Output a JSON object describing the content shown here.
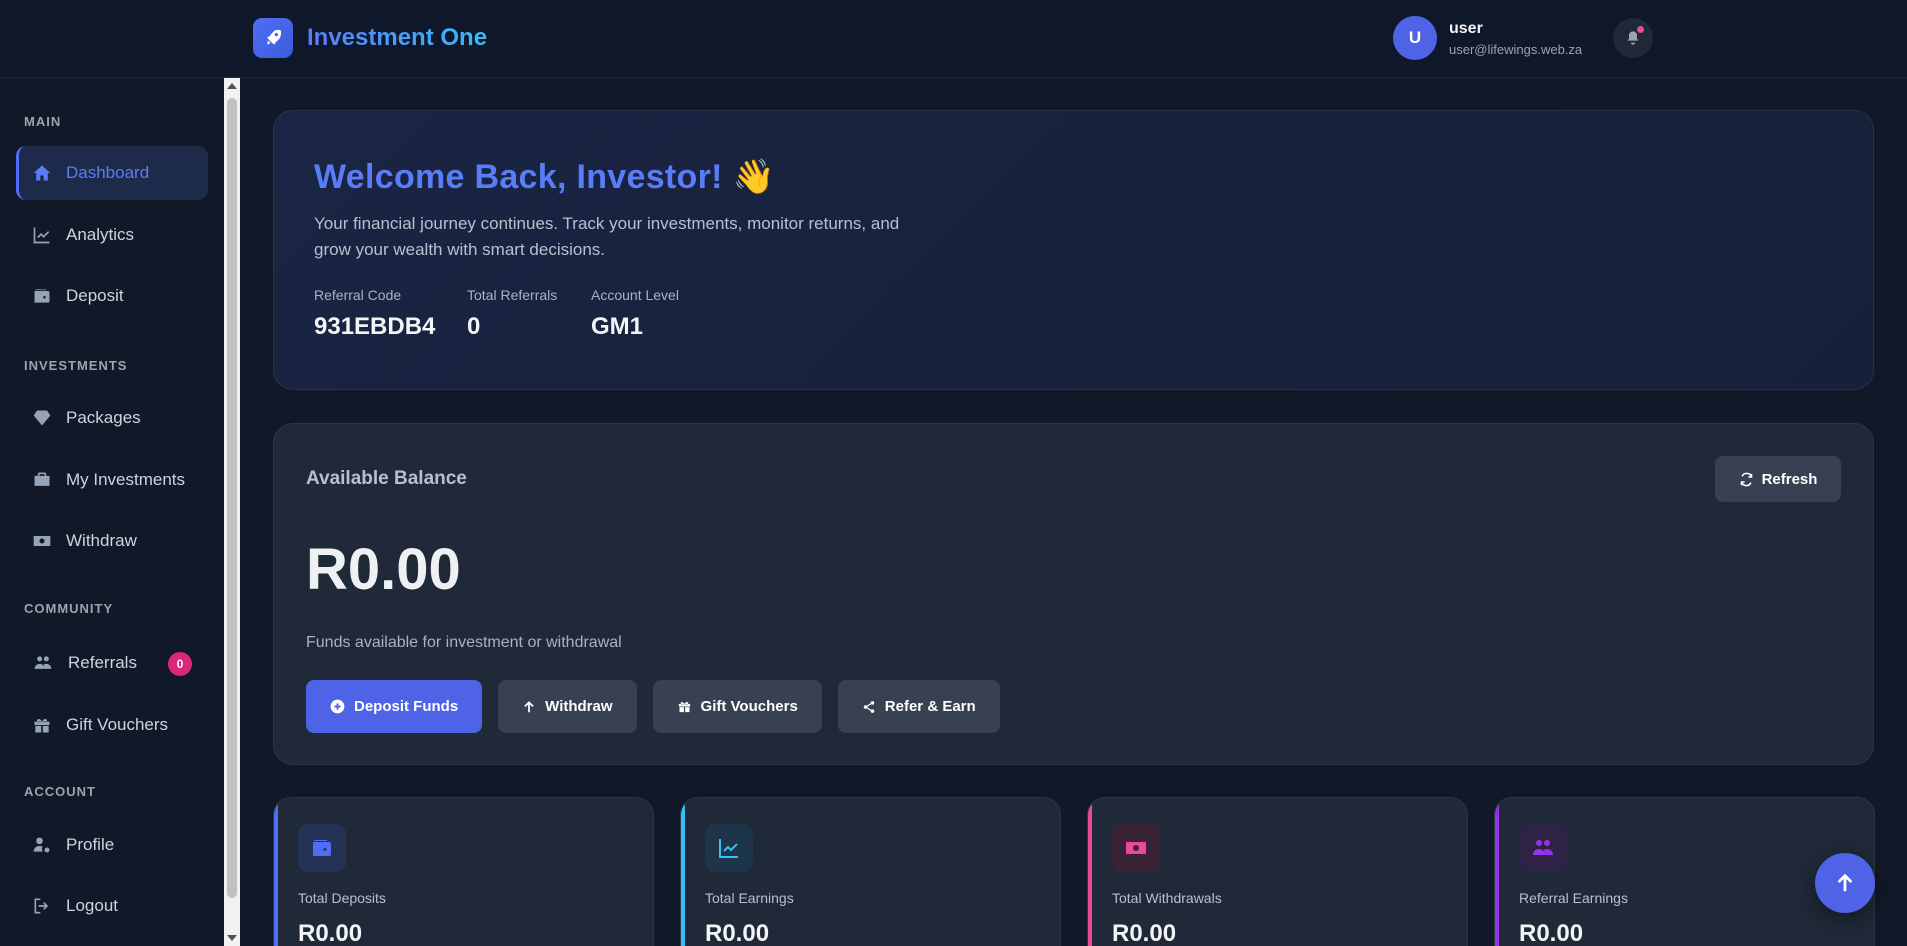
{
  "header": {
    "brand_name": "Investment One",
    "user_initial": "U",
    "user_name": "user",
    "user_email": "user@lifewings.web.za"
  },
  "sidebar": {
    "sections": {
      "main": "MAIN",
      "investments": "INVESTMENTS",
      "community": "COMMUNITY",
      "account": "ACCOUNT"
    },
    "items": [
      {
        "label": "Dashboard",
        "icon": "home-icon",
        "active": true
      },
      {
        "label": "Analytics",
        "icon": "chart-line-icon"
      },
      {
        "label": "Deposit",
        "icon": "wallet-icon"
      },
      {
        "label": "Packages",
        "icon": "gem-icon"
      },
      {
        "label": "My Investments",
        "icon": "briefcase-icon"
      },
      {
        "label": "Withdraw",
        "icon": "money-icon"
      },
      {
        "label": "Referrals",
        "icon": "users-icon",
        "badge": "0"
      },
      {
        "label": "Gift Vouchers",
        "icon": "gift-icon"
      },
      {
        "label": "Profile",
        "icon": "user-gear-icon"
      },
      {
        "label": "Logout",
        "icon": "logout-icon"
      }
    ]
  },
  "welcome": {
    "title": "Welcome Back, Investor!",
    "emoji": "👋",
    "description": "Your financial journey continues. Track your investments, monitor returns, and grow your wealth with smart decisions.",
    "stats": [
      {
        "label": "Referral Code",
        "value": "931EBDB4"
      },
      {
        "label": "Total Referrals",
        "value": "0"
      },
      {
        "label": "Account Level",
        "value": "GM1"
      }
    ]
  },
  "balance": {
    "title": "Available Balance",
    "refresh_label": "Refresh",
    "amount": "R0.00",
    "subtitle": "Funds available for investment or withdrawal",
    "actions": [
      "Deposit Funds",
      "Withdraw",
      "Gift Vouchers",
      "Refer & Earn"
    ]
  },
  "cards": [
    {
      "label": "Total Deposits",
      "value": "R0.00",
      "color": "#4f6ef7"
    },
    {
      "label": "Total Earnings",
      "value": "R0.00",
      "color": "#38bdf8"
    },
    {
      "label": "Total Withdrawals",
      "value": "R0.00",
      "color": "#ec4899"
    },
    {
      "label": "Referral Earnings",
      "value": "R0.00",
      "color": "#9333ea"
    }
  ]
}
